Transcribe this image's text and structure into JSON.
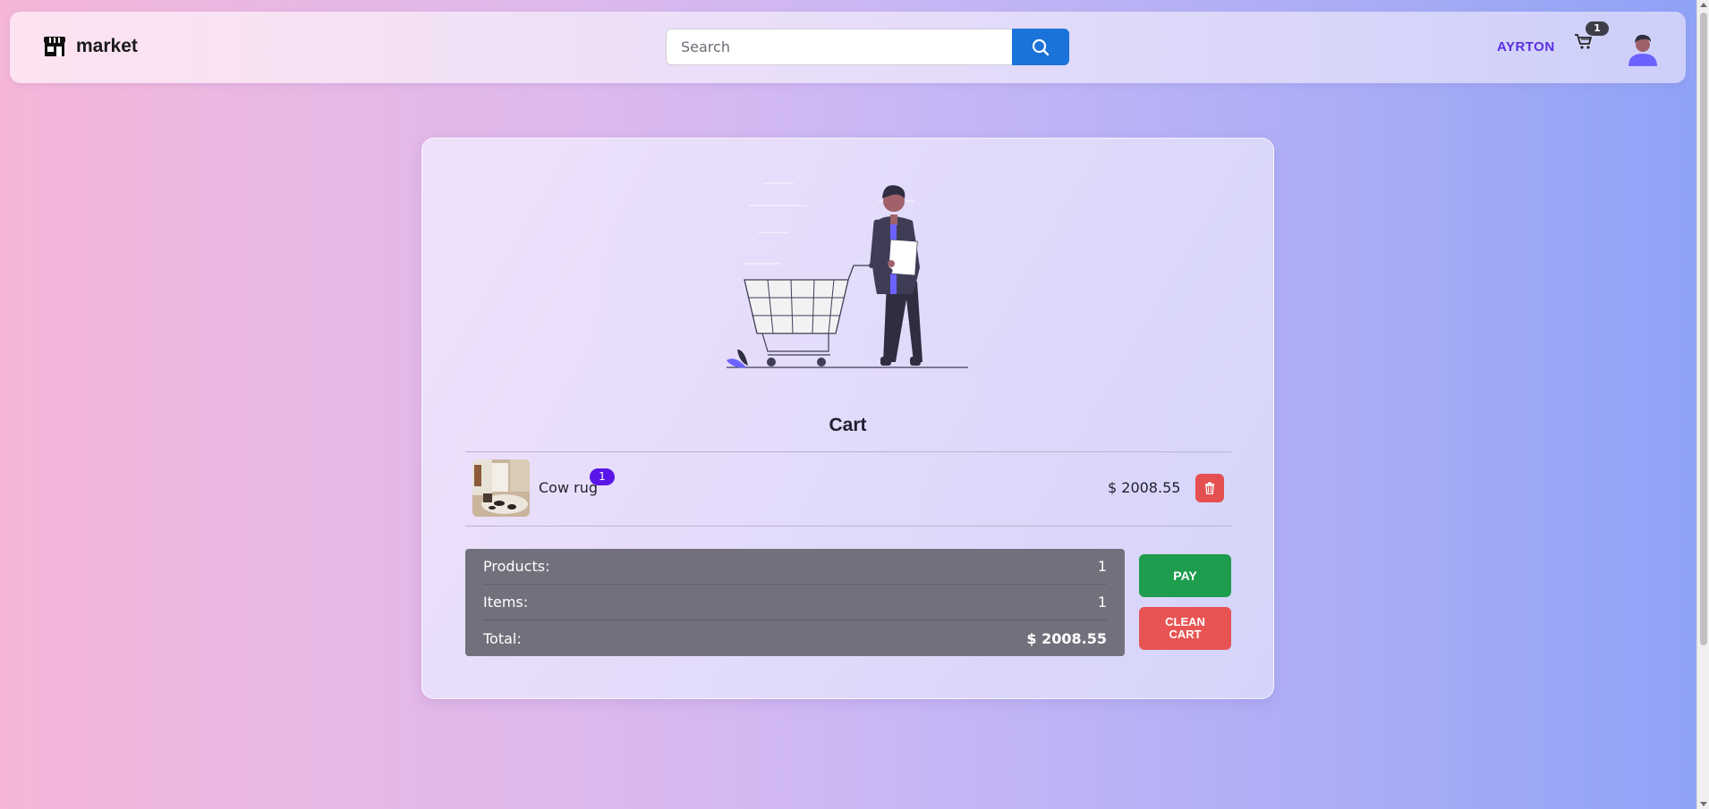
{
  "navbar": {
    "brand": "market",
    "search_placeholder": "Search",
    "search_value": "",
    "user_name": "AYRTON",
    "cart_count": "1"
  },
  "cart": {
    "title": "Cart",
    "items": [
      {
        "name": "Cow rug",
        "quantity": "1",
        "price": "$ 2008.55"
      }
    ],
    "summary": {
      "products_label": "Products:",
      "products_value": "1",
      "items_label": "Items:",
      "items_value": "1",
      "total_label": "Total:",
      "total_value": "$ 2008.55"
    },
    "pay_label": "PAY",
    "clean_label": "CLEAN CART"
  },
  "colors": {
    "primary": "#1a73d9",
    "accent": "#5a16e6",
    "success": "#1f9d4e",
    "danger": "#e45050"
  },
  "icons": [
    "store-icon",
    "search-icon",
    "cart-icon",
    "avatar",
    "trash-icon"
  ]
}
